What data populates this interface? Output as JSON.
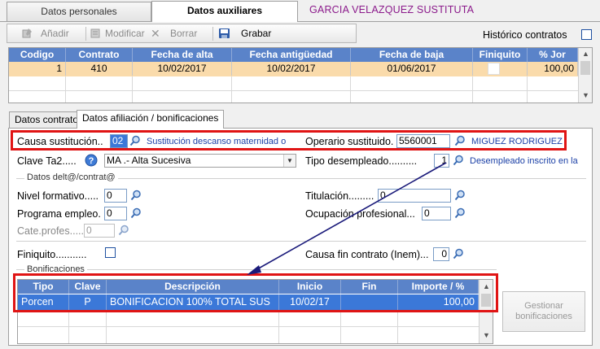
{
  "tabs": [
    "Datos personales",
    "Datos auxiliares"
  ],
  "person_name": "GARCIA  VELAZQUEZ SUSTITUTA",
  "toolbar": {
    "add": "Añadir",
    "modify": "Modificar",
    "delete": "Borrar",
    "save": "Grabar"
  },
  "historico_label": "Histórico contratos",
  "contracts_grid": {
    "headers": [
      "Codigo",
      "Contrato",
      "Fecha de alta",
      "Fecha antigüedad",
      "Fecha de baja",
      "Finiquito",
      "% Jor"
    ],
    "row": {
      "codigo": "1",
      "contrato": "410",
      "fecha_alta": "10/02/2017",
      "fecha_antiguedad": "10/02/2017",
      "fecha_baja": "01/06/2017",
      "finiquito": "",
      "jor": "100,00"
    }
  },
  "inner_tabs": [
    "Datos contrato",
    "Datos afiliación / bonificaciones"
  ],
  "form": {
    "causa_label": "Causa sustitución..",
    "causa_value": "02",
    "causa_desc": "Sustitución descanso maternidad o",
    "operario_label": "Operario sustituido.",
    "operario_value": "5560001",
    "operario_name": "MIGUEZ RODRIGUEZ",
    "clave_label": "Clave Ta2.....",
    "clave_value": "MA .- Alta Sucesiva",
    "tipo_desempleado_label": "Tipo desempleado..........",
    "tipo_desempleado_value": "1",
    "tipo_desempleado_desc": "Desempleado inscrito en la",
    "group_title": "Datos delt@/contrat@",
    "nivel_label": "Nivel formativo.....",
    "nivel_value": "0",
    "titulacion_label": "Titulación.........",
    "titulacion_value": "0",
    "programa_label": "Programa empleo.",
    "programa_value": "0",
    "ocupacion_label": "Ocupación profesional...",
    "ocupacion_value": "0",
    "cate_label": "Cate.profes.....",
    "cate_value": "0",
    "finiquito_label": "Finiquito...........",
    "causa_fin_label": "Causa fin contrato (Inem)...",
    "causa_fin_value": "0"
  },
  "bonificaciones": {
    "title": "Bonificaciones",
    "headers": [
      "Tipo",
      "Clave",
      "Descripción",
      "Inicio",
      "Fin",
      "Importe / %"
    ],
    "row": {
      "tipo": "Porcen",
      "clave": "P",
      "descripcion": "BONIFICACION 100% TOTAL SUS",
      "inicio": "10/02/17",
      "fin": "",
      "importe": "100,00"
    }
  },
  "gestionar_button": "Gestionar bonificaciones",
  "colors": {
    "header_blue": "#5a83c9",
    "selection_blue": "#3b78d8",
    "selected_row": "#fadbab",
    "highlight_red": "#e01414",
    "name_purple": "#8b1a8b"
  }
}
